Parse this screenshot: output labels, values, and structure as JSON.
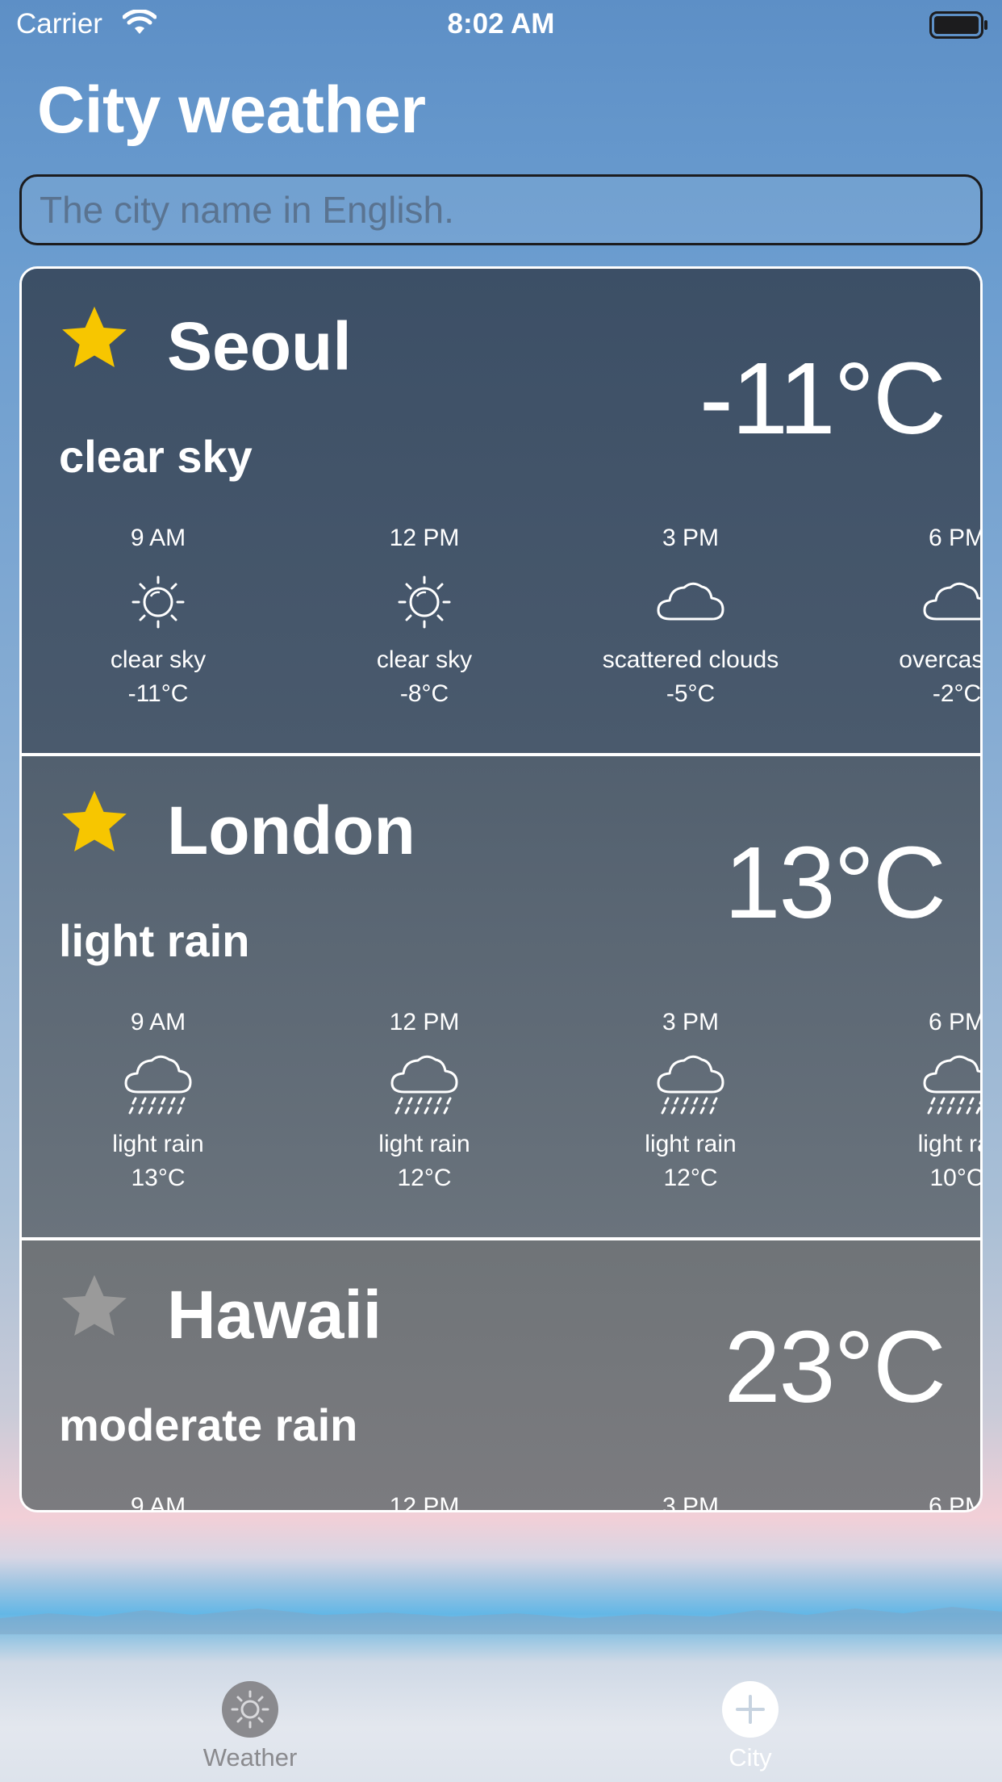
{
  "status_bar": {
    "carrier": "Carrier",
    "time": "8:02 AM"
  },
  "page_title": "City weather",
  "search": {
    "placeholder": "The city name in English.",
    "value": ""
  },
  "colors": {
    "star_favorite": "#f7c600",
    "star_default": "#9a9a9a",
    "tab_inactive": "#8a8a8e",
    "tab_active": "#ffffff"
  },
  "cities": [
    {
      "name": "Seoul",
      "favorite": true,
      "temp": "-11°C",
      "description": "clear sky",
      "forecast": [
        {
          "time": "9 AM",
          "icon": "sun-icon",
          "desc": "clear sky",
          "temp": "-11°C"
        },
        {
          "time": "12 PM",
          "icon": "sun-icon",
          "desc": "clear sky",
          "temp": "-8°C"
        },
        {
          "time": "3 PM",
          "icon": "cloud-icon",
          "desc": "scattered clouds",
          "temp": "-5°C"
        },
        {
          "time": "6 PM",
          "icon": "cloud-icon",
          "desc": "overcast cl",
          "temp": "-2°C"
        }
      ]
    },
    {
      "name": "London",
      "favorite": true,
      "temp": "13°C",
      "description": "light rain",
      "forecast": [
        {
          "time": "9 AM",
          "icon": "rain-cloud-icon",
          "desc": "light rain",
          "temp": "13°C"
        },
        {
          "time": "12 PM",
          "icon": "rain-cloud-icon",
          "desc": "light rain",
          "temp": "12°C"
        },
        {
          "time": "3 PM",
          "icon": "rain-cloud-icon",
          "desc": "light rain",
          "temp": "12°C"
        },
        {
          "time": "6 PM",
          "icon": "rain-cloud-icon",
          "desc": "light rai",
          "temp": "10°C"
        }
      ]
    },
    {
      "name": "Hawaii",
      "favorite": false,
      "temp": "23°C",
      "description": "moderate rain",
      "forecast": [
        {
          "time": "9 AM"
        },
        {
          "time": "12 PM"
        },
        {
          "time": "3 PM"
        },
        {
          "time": "6 PM"
        }
      ]
    }
  ],
  "tab_bar": {
    "tabs": [
      {
        "label": "Weather",
        "icon": "sun-circle-icon",
        "selected": false
      },
      {
        "label": "City",
        "icon": "plus-circle-icon",
        "selected": true
      }
    ]
  }
}
